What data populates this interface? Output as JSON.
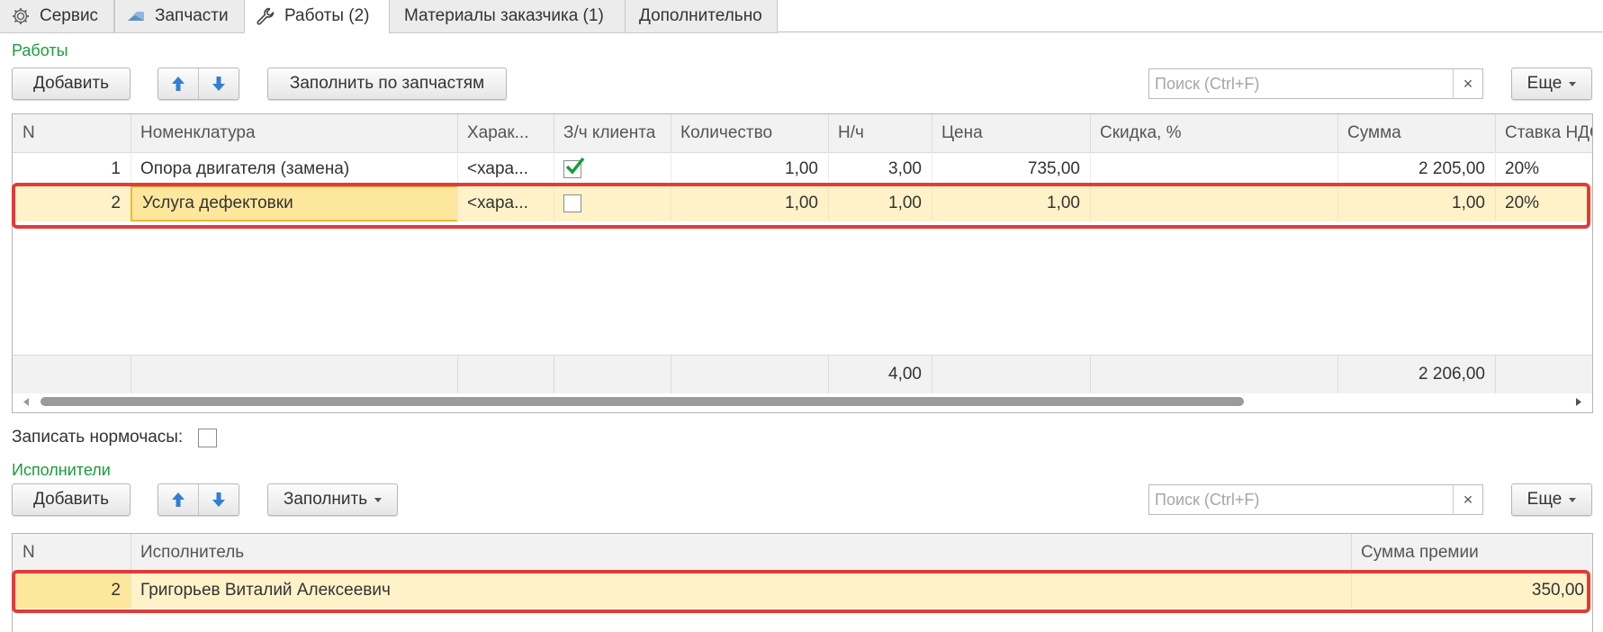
{
  "tabs": [
    {
      "label": "Сервис",
      "icon": "gear-icon"
    },
    {
      "label": "Запчасти",
      "icon": "parts-icon"
    },
    {
      "label": "Работы (2)",
      "icon": "wrench-icon"
    },
    {
      "label": "Материалы заказчика (1)",
      "icon": ""
    },
    {
      "label": "Дополнительно",
      "icon": ""
    }
  ],
  "works": {
    "title": "Работы",
    "add_label": "Добавить",
    "fill_label": "Заполнить по запчастям",
    "search_placeholder": "Поиск (Ctrl+F)",
    "search_clear": "×",
    "more_label": "Еще",
    "columns": [
      "N",
      "Номенклатура",
      "Харак...",
      "З/ч клиента",
      "Количество",
      "Н/ч",
      "Цена",
      "Скидка, %",
      "Сумма",
      "Ставка НДС"
    ],
    "rows": [
      {
        "n": "1",
        "item": "Опора двигателя (замена)",
        "char": "<хара...",
        "client_part": true,
        "qty": "1,00",
        "hours": "3,00",
        "price": "735,00",
        "discount": "",
        "sum": "2 205,00",
        "vat": "20%"
      },
      {
        "n": "2",
        "item": "Услуга дефектовки",
        "char": "<хара...",
        "client_part": false,
        "qty": "1,00",
        "hours": "1,00",
        "price": "1,00",
        "discount": "",
        "sum": "1,00",
        "vat": "20%"
      }
    ],
    "totals": {
      "hours": "4,00",
      "sum": "2 206,00"
    },
    "scroll_position": 0.79
  },
  "record_hours": {
    "label": "Записать нормочасы:",
    "checked": false
  },
  "performers": {
    "title": "Исполнители",
    "add_label": "Добавить",
    "fill_label": "Заполнить",
    "search_placeholder": "Поиск (Ctrl+F)",
    "search_clear": "×",
    "more_label": "Еще",
    "columns": [
      "N",
      "Исполнитель",
      "Сумма премии"
    ],
    "rows": [
      {
        "n": "2",
        "name": "Григорьев Виталий Алексеевич",
        "bonus": "350,00"
      }
    ]
  },
  "colors": {
    "accent_green": "#1a9c3a",
    "selected_row": "#fff2c9",
    "highlight_red": "#e23b3b",
    "arrow_blue": "#2f7fd6",
    "check_green": "#1a9c3a"
  }
}
